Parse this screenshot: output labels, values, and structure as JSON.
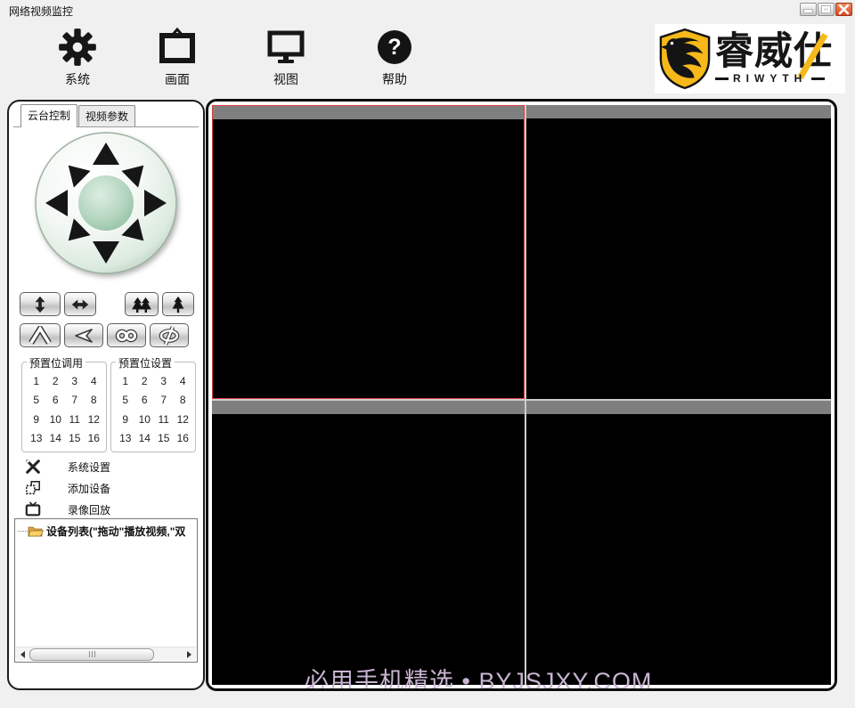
{
  "window": {
    "title": "网络视频监控",
    "controls": [
      {
        "icon": "minimize-icon"
      },
      {
        "icon": "maximize-icon"
      },
      {
        "icon": "close-icon"
      }
    ]
  },
  "toolbar": {
    "items": [
      {
        "label": "系统",
        "icon": "gear-icon"
      },
      {
        "label": "画面",
        "icon": "picture-frame-icon"
      },
      {
        "label": "视图",
        "icon": "monitor-icon"
      },
      {
        "label": "帮助",
        "icon": "help-icon",
        "glyph": "?"
      }
    ]
  },
  "brand": {
    "name": "睿威仕",
    "latin": "RIWYTH",
    "shield_icon": "eagle-shield-icon"
  },
  "ptz_panel": {
    "tabs": [
      {
        "label": "云台控制",
        "active": true
      },
      {
        "label": "视频参数",
        "active": false
      }
    ],
    "wheel_icon": "ptz-direction-wheel",
    "function_buttons": [
      {
        "icon": "vertical-scan-arrows-icon"
      },
      {
        "icon": "horizontal-scan-arrows-icon"
      },
      {
        "icon": "zoom-out-two-trees-icon"
      },
      {
        "icon": "zoom-in-tree-icon"
      },
      {
        "icon": "mountain-peak-icon"
      },
      {
        "icon": "left-arrow-icon"
      },
      {
        "icon": "infinity-icon"
      },
      {
        "icon": "slashed-eye-icon"
      }
    ],
    "preset_call": {
      "title": "预置位调用",
      "numbers": [
        "1",
        "2",
        "3",
        "4",
        "5",
        "6",
        "7",
        "8",
        "9",
        "10",
        "11",
        "12",
        "13",
        "14",
        "15",
        "16"
      ]
    },
    "preset_set": {
      "title": "预置位设置",
      "numbers": [
        "1",
        "2",
        "3",
        "4",
        "5",
        "6",
        "7",
        "8",
        "9",
        "10",
        "11",
        "12",
        "13",
        "14",
        "15",
        "16"
      ]
    },
    "menu": [
      {
        "label": "系统设置",
        "icon": "crossed-tools-icon"
      },
      {
        "label": "添加设备",
        "icon": "cascade-windows-icon"
      },
      {
        "label": "录像回放",
        "icon": "tv-icon"
      }
    ],
    "device_tree": {
      "folder_icon": "folder-icon",
      "root_label": "设备列表(\"拖动\"播放视频,\"双"
    }
  },
  "video_area": {
    "watermark": "必用手机精选 • BYJSJXY.COM",
    "cells": [
      {
        "selected": true
      },
      {
        "selected": false
      },
      {
        "selected": false
      },
      {
        "selected": false
      }
    ]
  },
  "colors": {
    "selection_red": "#e23b3b",
    "cell_titlebar_gray": "#7f7f7f",
    "brand_yellow": "#f6b919",
    "close_red": "#d64a2a",
    "window_bg": "#f0f0f0"
  }
}
